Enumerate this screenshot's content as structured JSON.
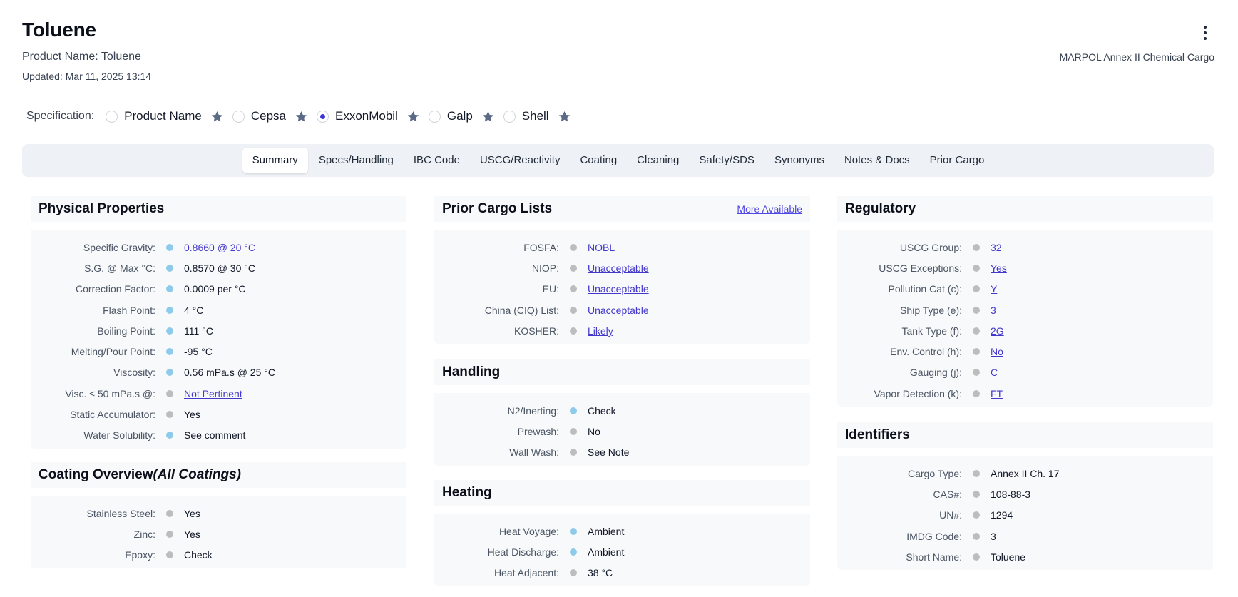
{
  "header": {
    "title": "Toluene",
    "product_name": "Product Name: Toluene",
    "updated": "Updated: Mar 11, 2025 13:14",
    "cargo_class": "MARPOL Annex II Chemical Cargo"
  },
  "specification": {
    "label": "Specification:",
    "options": [
      {
        "name": "Product Name",
        "selected": false
      },
      {
        "name": "Cepsa",
        "selected": false
      },
      {
        "name": "ExxonMobil",
        "selected": true
      },
      {
        "name": "Galp",
        "selected": false
      },
      {
        "name": "Shell",
        "selected": false
      }
    ]
  },
  "tabs": [
    "Summary",
    "Specs/Handling",
    "IBC Code",
    "USCG/Reactivity",
    "Coating",
    "Cleaning",
    "Safety/SDS",
    "Synonyms",
    "Notes & Docs",
    "Prior Cargo"
  ],
  "active_tab": "Summary",
  "colors": {
    "accent": "#3b36d6",
    "link": "#4338ca",
    "dot_blue": "#8ecbea",
    "dot_gray": "#bdbdbd"
  },
  "physical": {
    "title": "Physical Properties",
    "rows": [
      {
        "label": "Specific Gravity:",
        "value": "0.8660 @ 20 °C",
        "dot": "blue",
        "link": true
      },
      {
        "label": "S.G. @ Max °C:",
        "value": "0.8570 @ 30 °C",
        "dot": "blue",
        "link": false
      },
      {
        "label": "Correction Factor:",
        "value": "0.0009 per °C",
        "dot": "blue",
        "link": false
      },
      {
        "label": "Flash Point:",
        "value": "4 °C",
        "dot": "blue",
        "link": false
      },
      {
        "label": "Boiling Point:",
        "value": "111 °C",
        "dot": "blue",
        "link": false
      },
      {
        "label": "Melting/Pour Point:",
        "value": "-95 °C",
        "dot": "blue",
        "link": false
      },
      {
        "label": "Viscosity:",
        "value": "0.56 mPa.s @ 25 °C",
        "dot": "blue",
        "link": false
      },
      {
        "label": "Visc. ≤ 50 mPa.s @:",
        "value": "Not Pertinent",
        "dot": "gray",
        "link": true
      },
      {
        "label": "Static Accumulator:",
        "value": "Yes",
        "dot": "gray",
        "link": false
      },
      {
        "label": "Water Solubility:",
        "value": "See comment",
        "dot": "blue",
        "link": false
      }
    ]
  },
  "coating": {
    "title": "Coating Overview",
    "title_suffix": "(All Coatings)",
    "rows": [
      {
        "label": "Stainless Steel:",
        "value": "Yes",
        "dot": "gray",
        "link": false
      },
      {
        "label": "Zinc:",
        "value": "Yes",
        "dot": "gray",
        "link": false
      },
      {
        "label": "Epoxy:",
        "value": "Check",
        "dot": "gray",
        "link": false
      }
    ]
  },
  "prior_cargo": {
    "title": "Prior Cargo Lists",
    "more": "More Available",
    "rows": [
      {
        "label": "FOSFA:",
        "value": "NOBL",
        "dot": "gray",
        "link": true
      },
      {
        "label": "NIOP:",
        "value": "Unacceptable",
        "dot": "gray",
        "link": true
      },
      {
        "label": "EU:",
        "value": "Unacceptable",
        "dot": "gray",
        "link": true
      },
      {
        "label": "China (CIQ) List:",
        "value": "Unacceptable",
        "dot": "gray",
        "link": true
      },
      {
        "label": "KOSHER:",
        "value": "Likely",
        "dot": "gray",
        "link": true
      }
    ]
  },
  "handling": {
    "title": "Handling",
    "rows": [
      {
        "label": "N2/Inerting:",
        "value": "Check",
        "dot": "blue",
        "link": false
      },
      {
        "label": "Prewash:",
        "value": "No",
        "dot": "gray",
        "link": false
      },
      {
        "label": "Wall Wash:",
        "value": "See Note",
        "dot": "gray",
        "link": false
      }
    ]
  },
  "heating": {
    "title": "Heating",
    "rows": [
      {
        "label": "Heat Voyage:",
        "value": "Ambient",
        "dot": "blue",
        "link": false
      },
      {
        "label": "Heat Discharge:",
        "value": "Ambient",
        "dot": "blue",
        "link": false
      },
      {
        "label": "Heat Adjacent:",
        "value": "38 °C",
        "dot": "gray",
        "link": false
      }
    ]
  },
  "regulatory": {
    "title": "Regulatory",
    "rows": [
      {
        "label": "USCG Group:",
        "value": "32",
        "dot": "gray",
        "link": true
      },
      {
        "label": "USCG Exceptions:",
        "value": "Yes",
        "dot": "gray",
        "link": true
      },
      {
        "label": "Pollution Cat (c):",
        "value": "Y",
        "dot": "gray",
        "link": true
      },
      {
        "label": "Ship Type (e):",
        "value": "3",
        "dot": "gray",
        "link": true
      },
      {
        "label": "Tank Type (f):",
        "value": "2G",
        "dot": "gray",
        "link": true
      },
      {
        "label": "Env. Control (h):",
        "value": "No",
        "dot": "gray",
        "link": true
      },
      {
        "label": "Gauging (j):",
        "value": "C",
        "dot": "gray",
        "link": true
      },
      {
        "label": "Vapor Detection (k):",
        "value": "FT",
        "dot": "gray",
        "link": true
      }
    ]
  },
  "identifiers": {
    "title": "Identifiers",
    "rows": [
      {
        "label": "Cargo Type:",
        "value": "Annex II Ch. 17",
        "dot": "gray",
        "link": false
      },
      {
        "label": "CAS#:",
        "value": "108-88-3",
        "dot": "gray",
        "link": false
      },
      {
        "label": "UN#:",
        "value": "1294",
        "dot": "gray",
        "link": false
      },
      {
        "label": "IMDG Code:",
        "value": "3",
        "dot": "gray",
        "link": false
      },
      {
        "label": "Short Name:",
        "value": "Toluene",
        "dot": "gray",
        "link": false
      }
    ]
  }
}
